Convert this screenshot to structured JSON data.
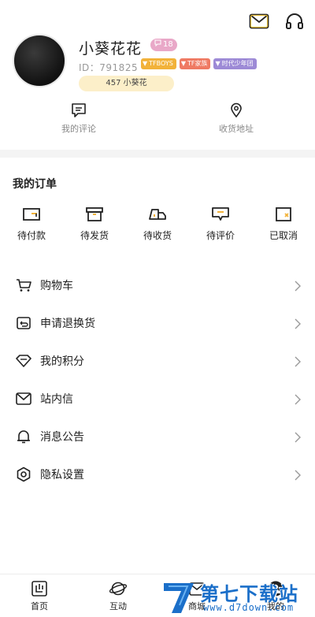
{
  "profile": {
    "nickname": "小葵花花",
    "level": "18",
    "id_label": "ID：791825",
    "tags": [
      "TFBOYS",
      "TF家族",
      "时代少年团"
    ],
    "fans_pill": "457 小葵花"
  },
  "top_icons": [
    "mail-icon",
    "headset-icon"
  ],
  "quick_links": [
    {
      "label": "我的评论",
      "icon": "comment-icon"
    },
    {
      "label": "收货地址",
      "icon": "location-icon"
    }
  ],
  "orders": {
    "title": "我的订单",
    "items": [
      {
        "label": "待付款",
        "icon": "wallet-icon"
      },
      {
        "label": "待发货",
        "icon": "box-icon"
      },
      {
        "label": "待收货",
        "icon": "truck-icon"
      },
      {
        "label": "待评价",
        "icon": "review-icon"
      },
      {
        "label": "已取消",
        "icon": "cancelled-icon"
      }
    ]
  },
  "menu": [
    {
      "label": "购物车",
      "icon": "cart-icon"
    },
    {
      "label": "申请退换货",
      "icon": "return-icon"
    },
    {
      "label": "我的积分",
      "icon": "diamond-icon"
    },
    {
      "label": "站内信",
      "icon": "mail-icon"
    },
    {
      "label": "消息公告",
      "icon": "bell-icon"
    },
    {
      "label": "隐私设置",
      "icon": "settings-icon"
    }
  ],
  "tabbar": [
    {
      "label": "首页",
      "icon": "home-icon"
    },
    {
      "label": "互动",
      "icon": "planet-icon"
    },
    {
      "label": "商城",
      "icon": "shop-icon"
    },
    {
      "label": "我的",
      "icon": "profile-icon"
    }
  ],
  "watermark": {
    "title": "第七下载站",
    "url": "www.d7down.com"
  },
  "colors": {
    "accent_yellow": "#fcefc9",
    "level_badge": "#e9a8c8",
    "watermark_blue": "#1b6fc9"
  }
}
